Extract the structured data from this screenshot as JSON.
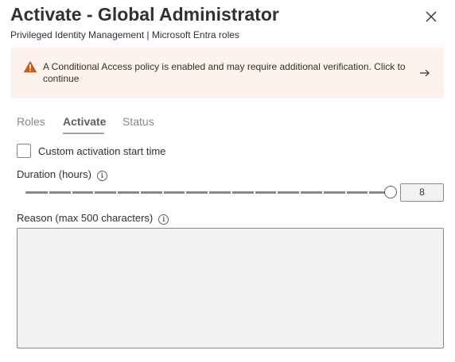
{
  "header": {
    "title": "Activate - Global Administrator",
    "subtitle": "Privileged Identity Management | Microsoft Entra roles",
    "close_icon": "close-icon"
  },
  "banner": {
    "icon": "warning-icon",
    "message": "A Conditional Access policy is enabled and may require additional verification. Click to continue",
    "arrow_icon": "arrow-right-icon",
    "background": "#fdf3ec",
    "icon_color": "#c05f18"
  },
  "tabs": [
    {
      "label": "Roles",
      "active": false
    },
    {
      "label": "Activate",
      "active": true
    },
    {
      "label": "Status",
      "active": false
    }
  ],
  "custom_start": {
    "label": "Custom activation start time",
    "checked": false
  },
  "duration": {
    "label": "Duration (hours)",
    "value": "8",
    "min": 0,
    "max": 8,
    "step": 0.5
  },
  "reason": {
    "label": "Reason (max 500 characters)",
    "value": ""
  }
}
